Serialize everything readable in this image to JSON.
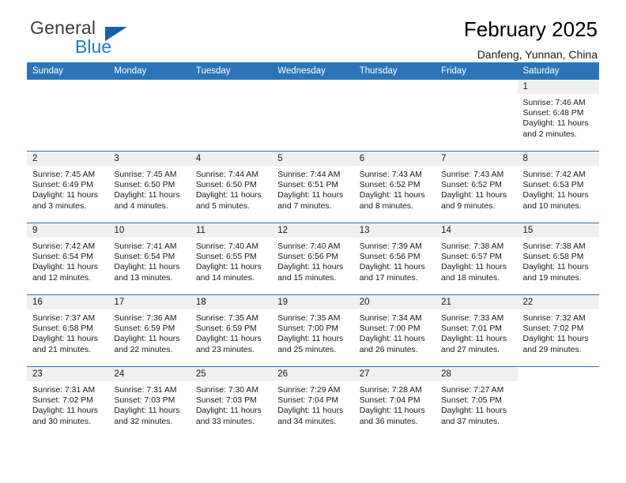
{
  "brand": {
    "name_part1": "General",
    "name_part2": "Blue",
    "triangle_color": "#1262a8",
    "blue": "#1f7bc1"
  },
  "header": {
    "title": "February 2025",
    "subtitle": "Danfeng, Yunnan, China"
  },
  "theme": {
    "header_blue": "#2b74b8",
    "day_strip_gray": "#f0f0f0",
    "text": "#1a1a1a"
  },
  "weekday_headers": [
    "Sunday",
    "Monday",
    "Tuesday",
    "Wednesday",
    "Thursday",
    "Friday",
    "Saturday"
  ],
  "weeks": [
    [
      {
        "blank": true
      },
      {
        "blank": true
      },
      {
        "blank": true
      },
      {
        "blank": true
      },
      {
        "blank": true
      },
      {
        "blank": true
      },
      {
        "day": "1",
        "sunrise": "Sunrise: 7:46 AM",
        "sunset": "Sunset: 6:48 PM",
        "daylight1": "Daylight: 11 hours",
        "daylight2": "and 2 minutes."
      }
    ],
    [
      {
        "day": "2",
        "sunrise": "Sunrise: 7:45 AM",
        "sunset": "Sunset: 6:49 PM",
        "daylight1": "Daylight: 11 hours",
        "daylight2": "and 3 minutes."
      },
      {
        "day": "3",
        "sunrise": "Sunrise: 7:45 AM",
        "sunset": "Sunset: 6:50 PM",
        "daylight1": "Daylight: 11 hours",
        "daylight2": "and 4 minutes."
      },
      {
        "day": "4",
        "sunrise": "Sunrise: 7:44 AM",
        "sunset": "Sunset: 6:50 PM",
        "daylight1": "Daylight: 11 hours",
        "daylight2": "and 5 minutes."
      },
      {
        "day": "5",
        "sunrise": "Sunrise: 7:44 AM",
        "sunset": "Sunset: 6:51 PM",
        "daylight1": "Daylight: 11 hours",
        "daylight2": "and 7 minutes."
      },
      {
        "day": "6",
        "sunrise": "Sunrise: 7:43 AM",
        "sunset": "Sunset: 6:52 PM",
        "daylight1": "Daylight: 11 hours",
        "daylight2": "and 8 minutes."
      },
      {
        "day": "7",
        "sunrise": "Sunrise: 7:43 AM",
        "sunset": "Sunset: 6:52 PM",
        "daylight1": "Daylight: 11 hours",
        "daylight2": "and 9 minutes."
      },
      {
        "day": "8",
        "sunrise": "Sunrise: 7:42 AM",
        "sunset": "Sunset: 6:53 PM",
        "daylight1": "Daylight: 11 hours",
        "daylight2": "and 10 minutes."
      }
    ],
    [
      {
        "day": "9",
        "sunrise": "Sunrise: 7:42 AM",
        "sunset": "Sunset: 6:54 PM",
        "daylight1": "Daylight: 11 hours",
        "daylight2": "and 12 minutes."
      },
      {
        "day": "10",
        "sunrise": "Sunrise: 7:41 AM",
        "sunset": "Sunset: 6:54 PM",
        "daylight1": "Daylight: 11 hours",
        "daylight2": "and 13 minutes."
      },
      {
        "day": "11",
        "sunrise": "Sunrise: 7:40 AM",
        "sunset": "Sunset: 6:55 PM",
        "daylight1": "Daylight: 11 hours",
        "daylight2": "and 14 minutes."
      },
      {
        "day": "12",
        "sunrise": "Sunrise: 7:40 AM",
        "sunset": "Sunset: 6:56 PM",
        "daylight1": "Daylight: 11 hours",
        "daylight2": "and 15 minutes."
      },
      {
        "day": "13",
        "sunrise": "Sunrise: 7:39 AM",
        "sunset": "Sunset: 6:56 PM",
        "daylight1": "Daylight: 11 hours",
        "daylight2": "and 17 minutes."
      },
      {
        "day": "14",
        "sunrise": "Sunrise: 7:38 AM",
        "sunset": "Sunset: 6:57 PM",
        "daylight1": "Daylight: 11 hours",
        "daylight2": "and 18 minutes."
      },
      {
        "day": "15",
        "sunrise": "Sunrise: 7:38 AM",
        "sunset": "Sunset: 6:58 PM",
        "daylight1": "Daylight: 11 hours",
        "daylight2": "and 19 minutes."
      }
    ],
    [
      {
        "day": "16",
        "sunrise": "Sunrise: 7:37 AM",
        "sunset": "Sunset: 6:58 PM",
        "daylight1": "Daylight: 11 hours",
        "daylight2": "and 21 minutes."
      },
      {
        "day": "17",
        "sunrise": "Sunrise: 7:36 AM",
        "sunset": "Sunset: 6:59 PM",
        "daylight1": "Daylight: 11 hours",
        "daylight2": "and 22 minutes."
      },
      {
        "day": "18",
        "sunrise": "Sunrise: 7:35 AM",
        "sunset": "Sunset: 6:59 PM",
        "daylight1": "Daylight: 11 hours",
        "daylight2": "and 23 minutes."
      },
      {
        "day": "19",
        "sunrise": "Sunrise: 7:35 AM",
        "sunset": "Sunset: 7:00 PM",
        "daylight1": "Daylight: 11 hours",
        "daylight2": "and 25 minutes."
      },
      {
        "day": "20",
        "sunrise": "Sunrise: 7:34 AM",
        "sunset": "Sunset: 7:00 PM",
        "daylight1": "Daylight: 11 hours",
        "daylight2": "and 26 minutes."
      },
      {
        "day": "21",
        "sunrise": "Sunrise: 7:33 AM",
        "sunset": "Sunset: 7:01 PM",
        "daylight1": "Daylight: 11 hours",
        "daylight2": "and 27 minutes."
      },
      {
        "day": "22",
        "sunrise": "Sunrise: 7:32 AM",
        "sunset": "Sunset: 7:02 PM",
        "daylight1": "Daylight: 11 hours",
        "daylight2": "and 29 minutes."
      }
    ],
    [
      {
        "day": "23",
        "sunrise": "Sunrise: 7:31 AM",
        "sunset": "Sunset: 7:02 PM",
        "daylight1": "Daylight: 11 hours",
        "daylight2": "and 30 minutes."
      },
      {
        "day": "24",
        "sunrise": "Sunrise: 7:31 AM",
        "sunset": "Sunset: 7:03 PM",
        "daylight1": "Daylight: 11 hours",
        "daylight2": "and 32 minutes."
      },
      {
        "day": "25",
        "sunrise": "Sunrise: 7:30 AM",
        "sunset": "Sunset: 7:03 PM",
        "daylight1": "Daylight: 11 hours",
        "daylight2": "and 33 minutes."
      },
      {
        "day": "26",
        "sunrise": "Sunrise: 7:29 AM",
        "sunset": "Sunset: 7:04 PM",
        "daylight1": "Daylight: 11 hours",
        "daylight2": "and 34 minutes."
      },
      {
        "day": "27",
        "sunrise": "Sunrise: 7:28 AM",
        "sunset": "Sunset: 7:04 PM",
        "daylight1": "Daylight: 11 hours",
        "daylight2": "and 36 minutes."
      },
      {
        "day": "28",
        "sunrise": "Sunrise: 7:27 AM",
        "sunset": "Sunset: 7:05 PM",
        "daylight1": "Daylight: 11 hours",
        "daylight2": "and 37 minutes."
      },
      {
        "blank": true
      }
    ]
  ]
}
